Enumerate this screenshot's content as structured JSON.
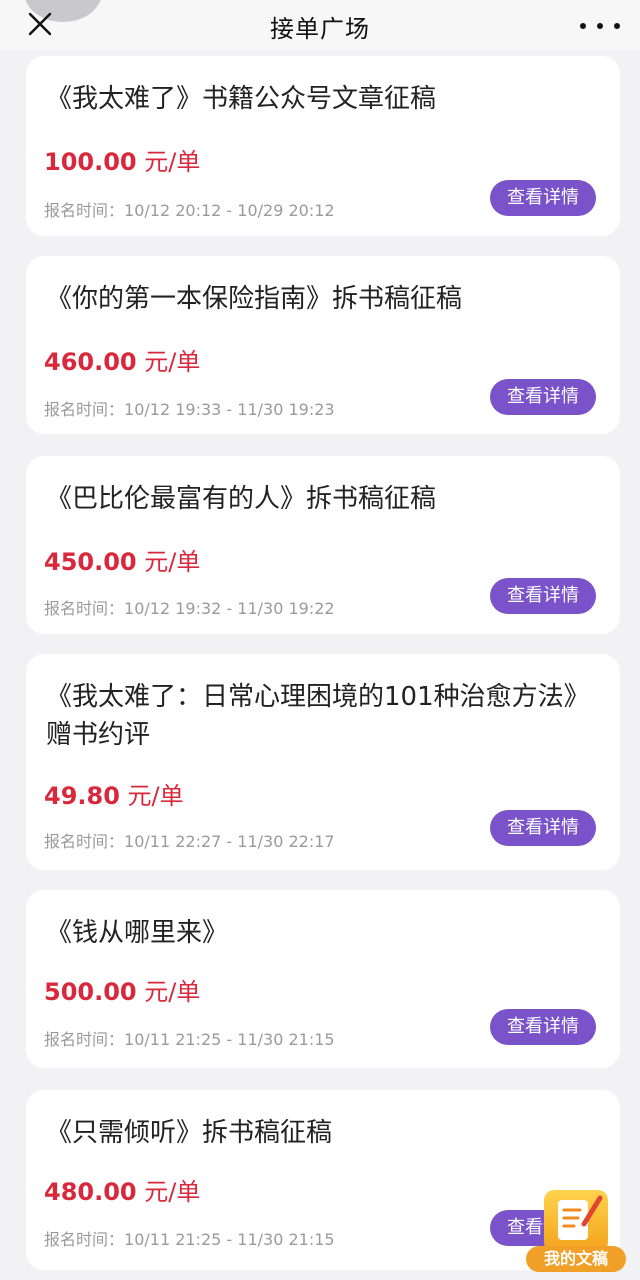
{
  "header": {
    "title": "接单广场"
  },
  "cards": [
    {
      "title": "《我太难了》书籍公众号文章征稿",
      "price": "100.00",
      "unit": " 元/单",
      "time_label": "报名时间：",
      "time_range": "10/12 20:12 - 10/29 20:12",
      "button": "查看详情"
    },
    {
      "title": "《你的第一本保险指南》拆书稿征稿",
      "price": "460.00",
      "unit": " 元/单",
      "time_label": "报名时间：",
      "time_range": "10/12 19:33 - 11/30 19:23",
      "button": "查看详情"
    },
    {
      "title": "《巴比伦最富有的人》拆书稿征稿",
      "price": "450.00",
      "unit": " 元/单",
      "time_label": "报名时间：",
      "time_range": "10/12 19:32 - 11/30 19:22",
      "button": "查看详情"
    },
    {
      "title": "《我太难了：日常心理困境的101种治愈方法》赠书约评",
      "price": "49.80",
      "unit": " 元/单",
      "time_label": "报名时间：",
      "time_range": "10/11 22:27 - 11/30 22:17",
      "button": "查看详情"
    },
    {
      "title": "《钱从哪里来》",
      "price": "500.00",
      "unit": " 元/单",
      "time_label": "报名时间：",
      "time_range": "10/11 21:25 - 11/30 21:15",
      "button": "查看详情"
    },
    {
      "title": "《只需倾听》拆书稿征稿",
      "price": "480.00",
      "unit": " 元/单",
      "time_label": "报名时间：",
      "time_range": "10/11 21:25 - 11/30 21:15",
      "button": "查看详情"
    }
  ],
  "fab": {
    "label": "我的文稿"
  },
  "colors": {
    "accent": "#7a52c9",
    "price": "#d9283c",
    "fab": "#f0a027"
  }
}
